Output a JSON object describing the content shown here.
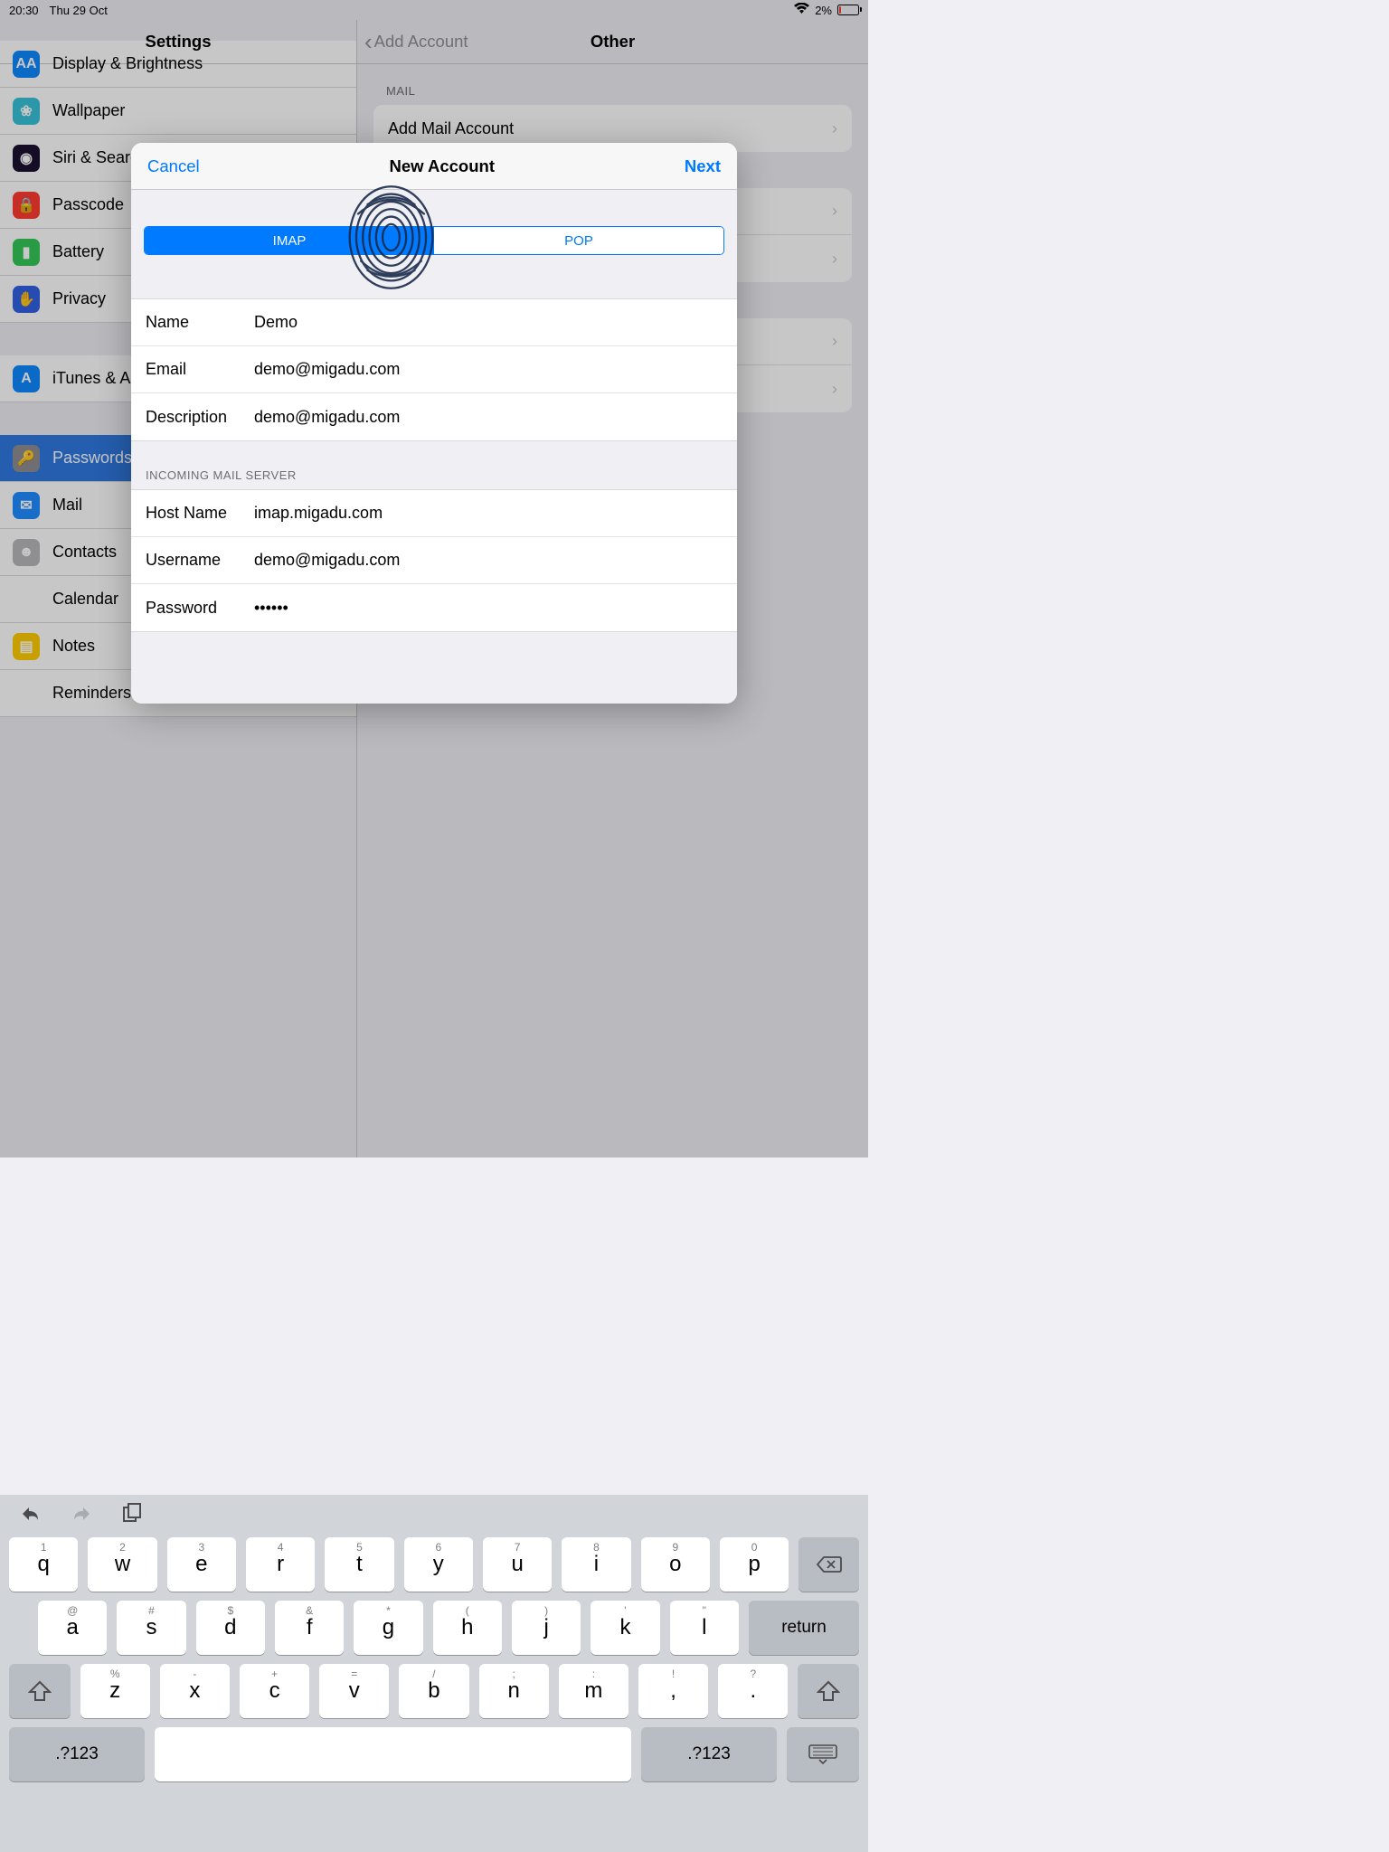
{
  "status": {
    "time": "20:30",
    "date": "Thu 29 Oct",
    "battery_pct": "2%"
  },
  "settings_title": "Settings",
  "sidebar": [
    {
      "label": "Display & Brightness",
      "icon_bg": "#1088ff",
      "icon_txt": "AA",
      "name": "display-brightness"
    },
    {
      "label": "Wallpaper",
      "icon_bg": "#38c1d8",
      "icon_txt": "❀",
      "name": "wallpaper"
    },
    {
      "label": "Siri & Search",
      "icon_bg": "#1b1130",
      "icon_txt": "◉",
      "name": "siri-search"
    },
    {
      "label": "Passcode",
      "icon_bg": "#ff3b30",
      "icon_txt": "🔒",
      "name": "passcode"
    },
    {
      "label": "Battery",
      "icon_bg": "#34c759",
      "icon_txt": "▮",
      "name": "battery"
    },
    {
      "label": "Privacy",
      "icon_bg": "#3161e3",
      "icon_txt": "✋",
      "name": "privacy"
    }
  ],
  "sidebar2": [
    {
      "label": "iTunes & App Store",
      "icon_bg": "#1088ff",
      "icon_txt": "A",
      "name": "itunes-appstore"
    }
  ],
  "sidebar3": [
    {
      "label": "Passwords & Accounts",
      "icon_bg": "#8e8e93",
      "icon_txt": "🔑",
      "name": "passwords-accounts",
      "selected": true
    },
    {
      "label": "Mail",
      "icon_bg": "#1e8cff",
      "icon_txt": "✉",
      "name": "mail"
    },
    {
      "label": "Contacts",
      "icon_bg": "#b7b7ba",
      "icon_txt": "☻",
      "name": "contacts"
    },
    {
      "label": "Calendar",
      "icon_bg": "#ffffff",
      "icon_txt": "▦",
      "name": "calendar"
    },
    {
      "label": "Notes",
      "icon_bg": "#ffcc00",
      "icon_txt": "▤",
      "name": "notes"
    },
    {
      "label": "Reminders",
      "icon_bg": "#ffffff",
      "icon_txt": "☰",
      "name": "reminders"
    }
  ],
  "right": {
    "back": "Add Account",
    "title": "Other",
    "mail_header": "MAIL",
    "add_mail": "Add Mail Account",
    "hidden_rows": [
      "",
      "",
      ""
    ]
  },
  "sheet": {
    "cancel": "Cancel",
    "title": "New Account",
    "next": "Next",
    "seg_imap": "IMAP",
    "seg_pop": "POP",
    "fields": {
      "name_label": "Name",
      "name": "Demo",
      "email_label": "Email",
      "email": "demo@migadu.com",
      "description_label": "Description",
      "description": "demo@migadu.com"
    },
    "incoming_header": "INCOMING MAIL SERVER",
    "incoming": {
      "host_label": "Host Name",
      "host": "imap.migadu.com",
      "user_label": "Username",
      "user": "demo@migadu.com",
      "pass_label": "Password",
      "pass": "••••••"
    }
  },
  "keyboard": {
    "row1": [
      {
        "m": "q",
        "s": "1"
      },
      {
        "m": "w",
        "s": "2"
      },
      {
        "m": "e",
        "s": "3"
      },
      {
        "m": "r",
        "s": "4"
      },
      {
        "m": "t",
        "s": "5"
      },
      {
        "m": "y",
        "s": "6"
      },
      {
        "m": "u",
        "s": "7"
      },
      {
        "m": "i",
        "s": "8"
      },
      {
        "m": "o",
        "s": "9"
      },
      {
        "m": "p",
        "s": "0"
      }
    ],
    "row2": [
      {
        "m": "a",
        "s": "@"
      },
      {
        "m": "s",
        "s": "#"
      },
      {
        "m": "d",
        "s": "$"
      },
      {
        "m": "f",
        "s": "&"
      },
      {
        "m": "g",
        "s": "*"
      },
      {
        "m": "h",
        "s": "("
      },
      {
        "m": "j",
        "s": ")"
      },
      {
        "m": "k",
        "s": "'"
      },
      {
        "m": "l",
        "s": "\""
      }
    ],
    "row3": [
      {
        "m": "z",
        "s": "%"
      },
      {
        "m": "x",
        "s": "-"
      },
      {
        "m": "c",
        "s": "+"
      },
      {
        "m": "v",
        "s": "="
      },
      {
        "m": "b",
        "s": "/"
      },
      {
        "m": "n",
        "s": ";"
      },
      {
        "m": "m",
        "s": ":"
      },
      {
        "m": ",",
        "s": "!"
      },
      {
        "m": ".",
        "s": "?"
      }
    ],
    "symbols": ".?123",
    "return": "return"
  }
}
